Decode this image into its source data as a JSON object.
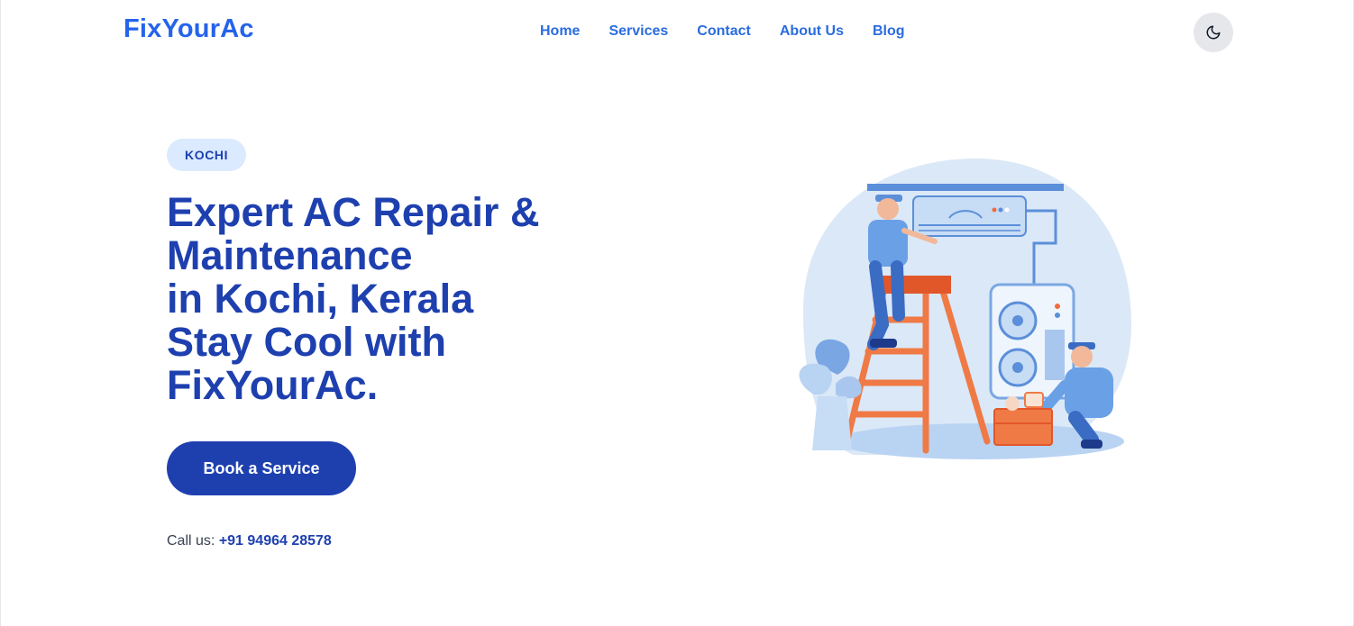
{
  "header": {
    "logo": "FixYourAc",
    "nav": [
      "Home",
      "Services",
      "Contact",
      "About Us",
      "Blog"
    ],
    "theme_toggle_icon": "moon-icon"
  },
  "hero": {
    "badge": "KOCHI",
    "title_lines": [
      "Expert AC Repair &",
      "Maintenance",
      "in Kochi, Kerala",
      "Stay Cool with",
      "FixYourAc."
    ],
    "cta_label": "Book a Service",
    "call_label": "Call us:",
    "call_number": "+91 94964 28578"
  },
  "colors": {
    "brand": "#2563eb",
    "primary_dark": "#1e40af",
    "badge_bg": "#dbeafe",
    "toggle_bg": "#e5e7eb"
  }
}
